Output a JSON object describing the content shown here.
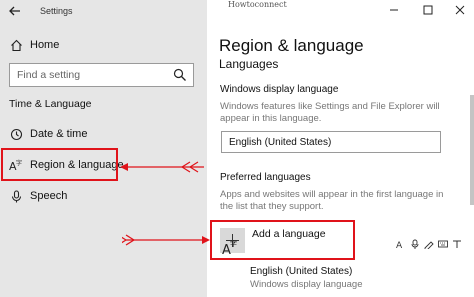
{
  "window": {
    "app_title": "Settings",
    "watermark": "Howtoconnect"
  },
  "nav": {
    "home_label": "Home",
    "search_placeholder": "Find a setting",
    "section_heading": "Time & Language",
    "items": [
      {
        "label": "Date & time",
        "icon": "clock-icon"
      },
      {
        "label": "Region & language",
        "icon": "language-icon",
        "selected": true
      },
      {
        "label": "Speech",
        "icon": "microphone-icon"
      }
    ]
  },
  "content": {
    "page_title": "Region & language",
    "languages_heading": "Languages",
    "display_language": {
      "label": "Windows display language",
      "description_line1": "Windows features like Settings and File Explorer will",
      "description_line2": "appear in this language.",
      "selected": "English (United States)"
    },
    "preferred": {
      "label": "Preferred languages",
      "description_line1": "Apps and websites will appear in the first language in",
      "description_line2": "the list that they support.",
      "add_label": "Add a language",
      "languages": [
        {
          "name": "English (United States)",
          "subtitle": "Windows display language"
        }
      ]
    }
  },
  "colors": {
    "highlight_red": "#e0131a",
    "nav_bg": "#e6e6e6"
  }
}
